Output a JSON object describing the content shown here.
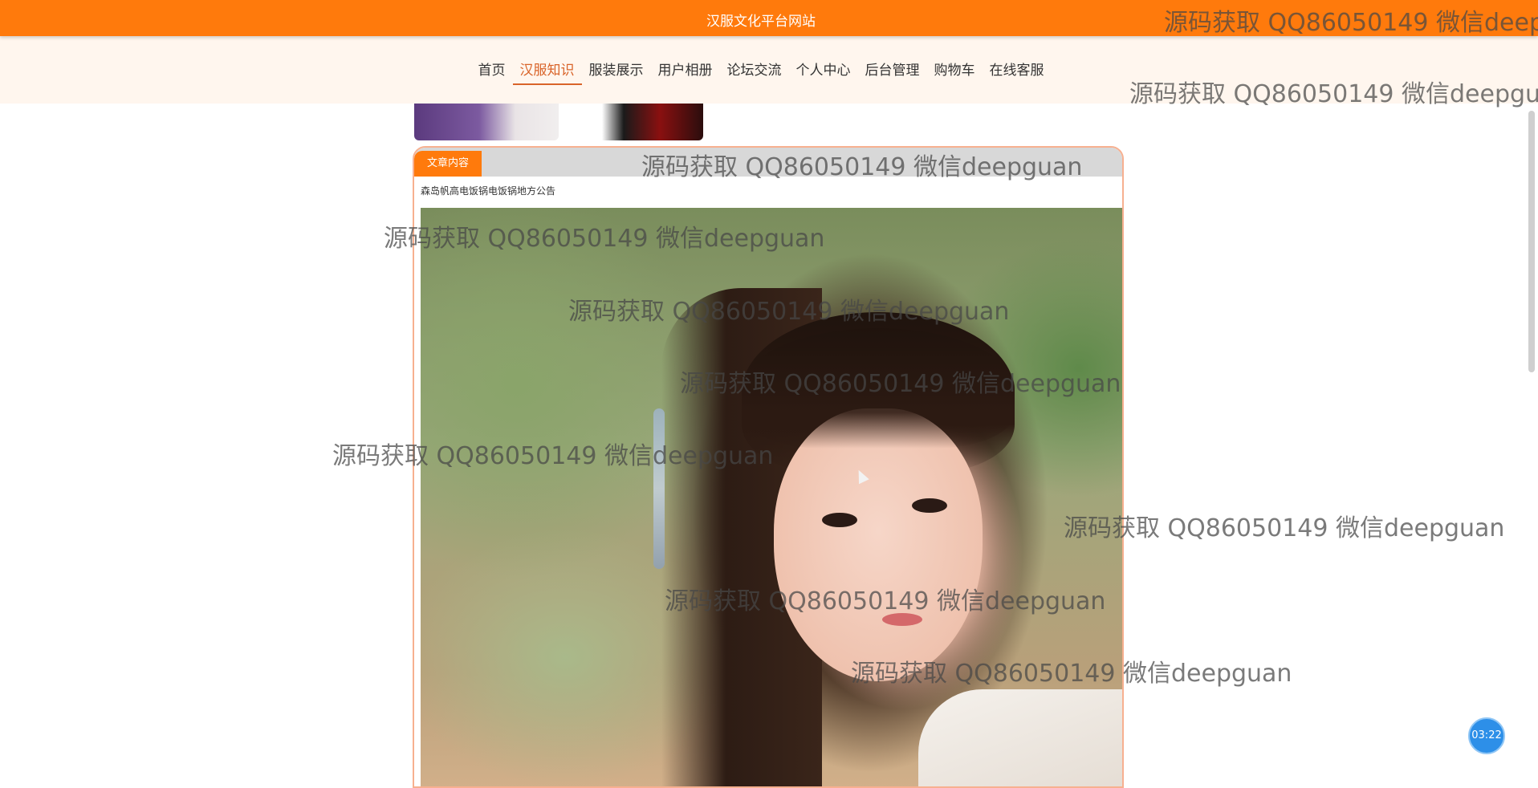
{
  "site_title": "汉服文化平台网站",
  "nav": {
    "items": [
      "首页",
      "汉服知识",
      "服装展示",
      "用户相册",
      "论坛交流",
      "个人中心",
      "后台管理",
      "购物车",
      "在线客服"
    ],
    "active": "汉服知识"
  },
  "article": {
    "tab_label": "文章内容",
    "title": "森岛帆高电饭锅电饭锅地方公告"
  },
  "watermark_text": "源码获取 QQ86050149 微信deepguan",
  "watermark_text_cropped": "源码获取 QQ86050149 微信deepg",
  "timer": "03:22",
  "colors": {
    "header_orange": "#ff7a0c",
    "nav_background": "#fff6ee",
    "active_nav": "#d9642a",
    "timer_blue": "#2d8fe8"
  }
}
